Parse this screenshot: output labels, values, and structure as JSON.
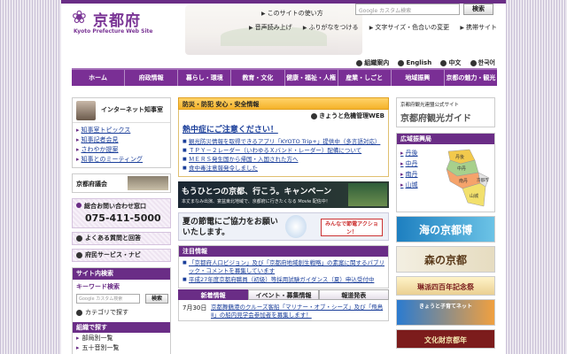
{
  "header": {
    "logo_jp": "京都府",
    "logo_en": "Kyoto Prefecture Web Site",
    "util_links": [
      "このサイトの使い方"
    ],
    "search_placeholder": "Google カスタム検索",
    "search_button": "検索",
    "util2": [
      "音声読み上げ",
      "ふりがなをつける",
      "文字サイズ・色合いの変更",
      "携帯サイト"
    ]
  },
  "lang": [
    "組織案内",
    "English",
    "中文",
    "한국어"
  ],
  "nav": [
    "ホーム",
    "府政情報",
    "暮らし・環境",
    "教育・文化",
    "健康・福祉・人権",
    "産業・しごと",
    "地域振興",
    "京都の魅力・観光"
  ],
  "left": {
    "governor_title": "インターネット知事室",
    "governor_links": [
      "知事室トピックス",
      "知事記者会見",
      "さわやか提案",
      "知事とのミーティング"
    ],
    "council": "京都府議会",
    "contact_label": "総合お問い合わせ窓口",
    "contact_phone": "075-411-5000",
    "menu": [
      "よくある質問と回答",
      "府民サービス・ナビ"
    ],
    "search_header": "サイト内検索",
    "keyword_label": "キーワード検索",
    "search_placeholder": "Google カスタム検索",
    "search_button": "検索",
    "category": "カテゴリで探す",
    "org_header": "組織で探す",
    "org_links": [
      "部局別一覧",
      "五十音別一覧"
    ]
  },
  "center": {
    "safety_header": "防災・防犯 安心・安全情報",
    "crisis_link": "きょうと危機管理WEB",
    "alert": "熱中症にご注意ください！",
    "safety_news": [
      "観光防災情報を取得できるアプリ「KYOTO Trip+」提供中（多言語対応）",
      "ＴＰＹ－２レーダー（いわゆるＸバンド・レーダー）配備について",
      "ＭＥＲＳ発生国から帰国・入国された方へ",
      "食中毒注意報発令しました"
    ],
    "banner1_title": "もうひとつの京都、行こう。キャンペーン",
    "banner1_sub": "本丈まなみ出演、宴盆東北地域で、京都府に行きたくなる Movie 配信中！",
    "banner2_title": "夏の節電にご協力をお願いいたします。",
    "banner2_tag": "みんなで節電アクション！",
    "notice_header": "注目情報",
    "notices": [
      "「京都府人口ビジョン」及び「京都府地域創生戦略」の素案に関するパブリック・コメントを募集しています",
      "平成27年度京都府職員（初級）等採用試験ガイダンス（夏）申込受付中"
    ],
    "tabs": [
      "新着情報",
      "イベント・募集情報",
      "報道発表"
    ],
    "news_date": "7月30日",
    "news_text": "京都舞鶴港のクルーズ客船「マリナー・オブ・シーズ」及び「飛鳥Ⅱ」の船内見学会参加者を募集します！"
  },
  "right": {
    "guide_sub": "京都府観光連盟公式サイト",
    "guide_title": "京都府観光ガイド",
    "area_header": "広域振興局",
    "area_links": [
      "丹後",
      "中丹",
      "南丹",
      "山城"
    ],
    "map_labels": [
      "丹後",
      "中丹",
      "南丹",
      "京都市",
      "山城"
    ],
    "banners": [
      "海の京都博",
      "森の京都",
      "琳派四百年記念祭",
      "きょうと子育てネット",
      "文化財京都年"
    ]
  }
}
